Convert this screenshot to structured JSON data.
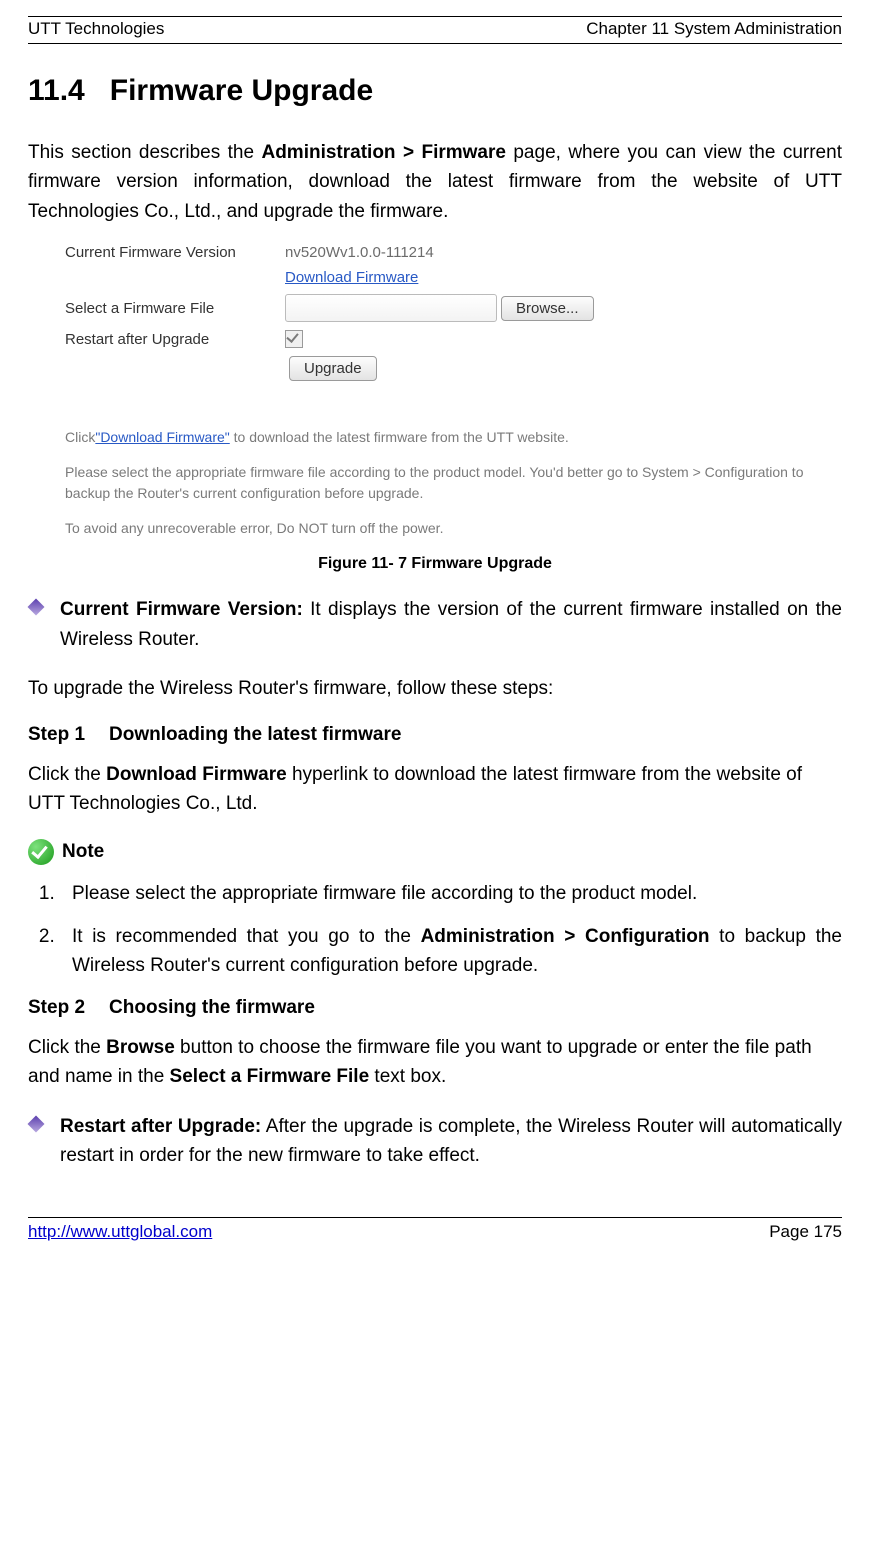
{
  "header": {
    "left": "UTT Technologies",
    "right": "Chapter 11 System Administration"
  },
  "section": {
    "number": "11.4",
    "title": "Firmware Upgrade"
  },
  "intro": {
    "pre": "This section describes the ",
    "bold": "Administration > Firmware",
    "post": " page, where you can view the current firmware version information, download the latest firmware from the website of UTT Technologies Co., Ltd., and upgrade the firmware."
  },
  "figure": {
    "caption": "Figure 11- 7 Firmware Upgrade",
    "ui": {
      "row_version_label": "Current Firmware Version",
      "row_version_value": "nv520Wv1.0.0-111214",
      "download_link": "Download Firmware",
      "row_select_label": "Select a Firmware File",
      "browse_btn": "Browse...",
      "restart_label": "Restart after Upgrade",
      "upgrade_btn": "Upgrade",
      "help1_pre": "Click",
      "help1_link": "\"Download Firmware\"",
      "help1_post": " to download the latest firmware from the UTT website.",
      "help2": "Please select the appropriate firmware file according to the product model. You'd better go to System > Configuration to backup the Router's current configuration before upgrade.",
      "help3": "To avoid any unrecoverable error, Do NOT turn off the power."
    }
  },
  "bullet1": {
    "bold": "Current Firmware Version:",
    "text": " It displays the version of the current firmware installed on the Wireless Router."
  },
  "para_upgrade_intro": "To upgrade the Wireless Router's firmware, follow these steps:",
  "step1": {
    "label": "Step 1",
    "title": "Downloading the latest firmware",
    "body_pre": "Click the ",
    "body_bold": "Download Firmware",
    "body_post": " hyperlink to download the latest firmware from the website of UTT Technologies Co., Ltd."
  },
  "note_label": "Note",
  "notes": {
    "n1": "Please select the appropriate firmware file according to the product model.",
    "n2_pre": "It is recommended that you go to the ",
    "n2_bold": "Administration > Configuration",
    "n2_post": " to backup the Wireless Router's current configuration before upgrade."
  },
  "step2": {
    "label": "Step 2",
    "title": "Choosing the firmware",
    "body_pre": "Click the ",
    "body_bold1": "Browse",
    "body_mid": " button to choose the firmware file you want to upgrade or enter the file path and name in the ",
    "body_bold2": "Select a Firmware File",
    "body_post": " text box."
  },
  "bullet2": {
    "bold": "Restart after Upgrade:",
    "text": " After the upgrade is complete, the Wireless Router will automatically restart in order for the new firmware to take effect."
  },
  "footer": {
    "url": "http://www.uttglobal.com",
    "page": "Page 175"
  }
}
